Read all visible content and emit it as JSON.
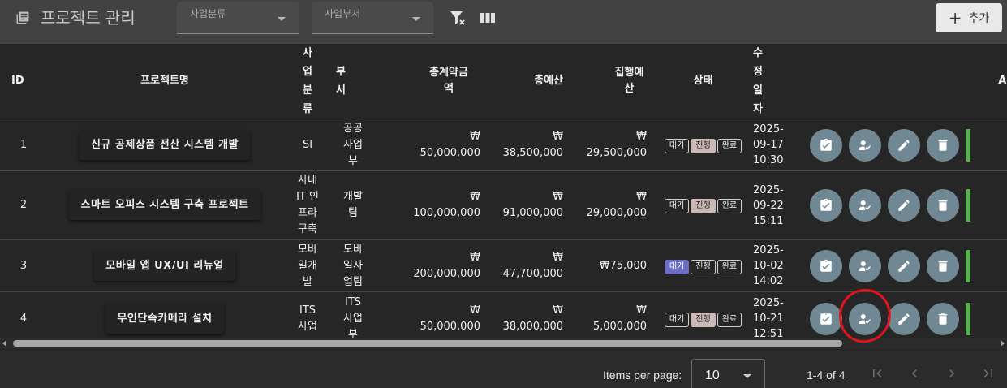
{
  "toolbar": {
    "title": "프로젝트 관리",
    "business_type_label": "사업분류",
    "department_label": "사업부서",
    "add_label": "추가"
  },
  "table": {
    "headers": {
      "id": "ID",
      "name": "프로젝트명",
      "type": "사\n업\n분\n류",
      "dept": "부\n서",
      "contract": "총계약금\n액",
      "budget": "총예산",
      "exec": "집행예\n산",
      "status": "상태",
      "date": "수\n정\n일\n자",
      "actions": "Ac"
    },
    "status_chips": [
      "대기",
      "진행",
      "완료"
    ],
    "rows": [
      {
        "id": "1",
        "name": "신규 공제상품 전산 시스템 개발",
        "type": "SI",
        "dept": "공공\n사업\n부",
        "contract": "₩\n50,000,000",
        "budget": "₩\n38,500,000",
        "exec": "₩\n29,500,000",
        "status": "진행",
        "date": "2025-\n09-17\n10:30"
      },
      {
        "id": "2",
        "name": "스마트 오피스 시스템 구축 프로젝트",
        "type": "사내\nIT 인\n프라\n구축",
        "dept": "개발\n팀",
        "contract": "₩\n100,000,000",
        "budget": "₩\n91,000,000",
        "exec": "₩\n29,000,000",
        "status": "진행",
        "date": "2025-\n09-22\n15:11"
      },
      {
        "id": "3",
        "name": "모바일 앱 UX/UI 리뉴얼",
        "type": "모바\n일개\n발",
        "dept": "모바\n일사\n업팀",
        "contract": "₩\n200,000,000",
        "budget": "₩\n47,700,000",
        "exec": "₩75,000",
        "status": "대기",
        "date": "2025-\n10-02\n14:02"
      },
      {
        "id": "4",
        "name": "무인단속카메라 설치",
        "type": "ITS\n사업",
        "dept": "ITS\n사업\n부",
        "contract": "₩\n50,000,000",
        "budget": "₩\n38,000,000",
        "exec": "₩\n5,000,000",
        "status": "진행",
        "date": "2025-\n10-21\n12:51"
      }
    ]
  },
  "paginator": {
    "items_per_page_label": "Items per page:",
    "items_per_page_value": "10",
    "range_label": "1-4 of 4"
  },
  "colors": {
    "action_button": "#6f8894",
    "status_active": "#cbb9b5",
    "status_waiting": "#6e6fc4",
    "annotation": "#e0141e"
  }
}
